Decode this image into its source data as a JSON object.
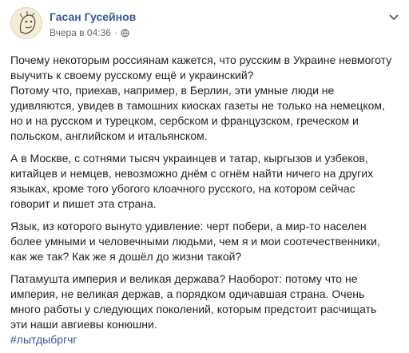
{
  "post": {
    "author": "Гасан Гусейнов",
    "timestamp": "Вчера в 04:36",
    "separator": "·",
    "privacy_icon": "globe-icon",
    "menu_icon": "chevron-down-icon",
    "avatar_icon": "cartoon-avatar-icon",
    "paragraphs": [
      [
        "Почему некоторым россиянам кажется, что русским в Украине невмоготу",
        "выучить к своему русскому ещё и украинский?",
        "Потому что, приехав, например, в Берлин, эти умные люди не",
        "удивляются, увидев в тамошних киосках газеты не только на немецком,",
        "но и на русском и турецком, сербском и французском, греческом и",
        "польском, английском и итальянском."
      ],
      [
        "А в Москве, с сотнями тысяч украинцев и татар, кыргызов и узбеков,",
        "китайцев и немцев, невозможно днём с огнём найти ничего на других",
        "языках, кроме того убогого клоачного русского, на котором сейчас",
        "говорит и пишет эта страна."
      ],
      [
        "Язык, из которого вынуто удивление: черт побери, а мир-то населен",
        "более умными и человечными людьми, чем я и мои соотечественники,",
        "как же так? Как же я дошёл до жизни такой?"
      ],
      [
        "Патамушта империя и великая держава? Наоборот: потому что не",
        "империя, не великая держав, а порядком одичавшая страна. Очень",
        "много работы у следующих поколений, которым предстоит расчищать",
        "эти наши авгиевы конюшни."
      ]
    ],
    "hashtag": "#лытдыбргчг"
  },
  "colors": {
    "link": "#385898",
    "text": "#1d2129",
    "meta": "#616770",
    "background": "#ffffff"
  }
}
